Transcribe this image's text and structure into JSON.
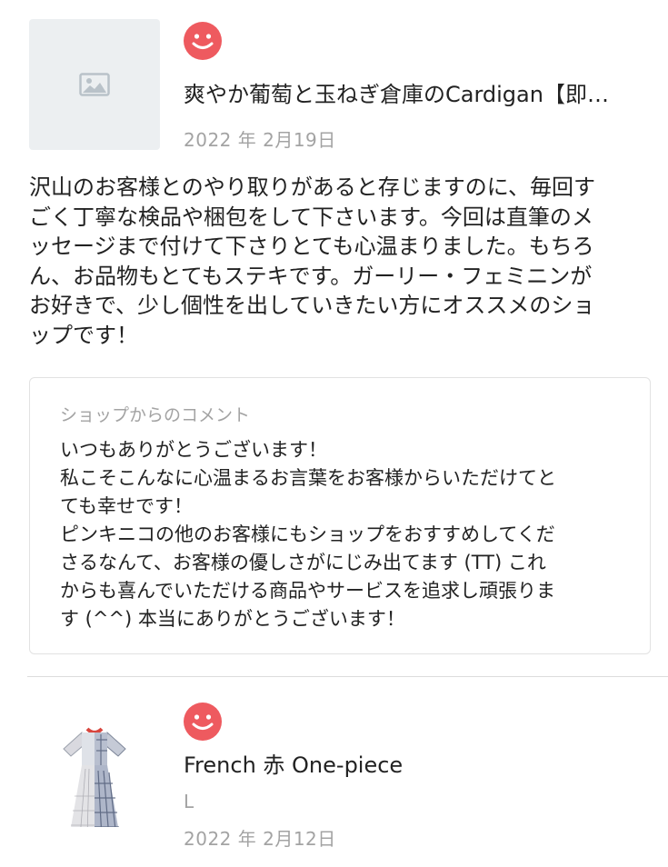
{
  "reviews": [
    {
      "product_title": "爽やか葡萄と玉ねぎ倉庫のCardigan【即…",
      "rating_icon": "smiley-face-icon",
      "date": "2022 年 2月19日",
      "body": "沢山のお客様とのやり取りがあると存じますのに、毎回す\nごく丁寧な検品や梱包をして下さいます。今回は直筆のメ\nッセージまで付けて下さりとても心温まりました。もちろ\nん、お品物もとてもステキです。ガーリー・フェミニンが\nお好きで、少し個性を出していきたい方にオススメのショ\nップです！",
      "shop_reply": {
        "heading": "ショップからのコメント",
        "body": "いつもありがとうございます！\n私こそこんなに心温まるお言葉をお客様からいただけてと\nても幸せです！\nピンキニコの他のお客様にもショップをおすすめしてくだ\nさるなんて、お客様の優しさがにじみ出てます (TT) これ\nからも喜んでいただける商品やサービスを追求し頑張りま\nす (^^) 本当にありがとうございます！"
      }
    },
    {
      "product_title": "French 赤 One-piece",
      "variant": "L",
      "rating_icon": "smiley-face-icon",
      "date": "2022 年 2月12日"
    }
  ],
  "colors": {
    "smiley": "#ee5a5f",
    "date_text": "#a3a3a3",
    "placeholder_bg": "#eceff1",
    "border": "#e2e2e2"
  }
}
